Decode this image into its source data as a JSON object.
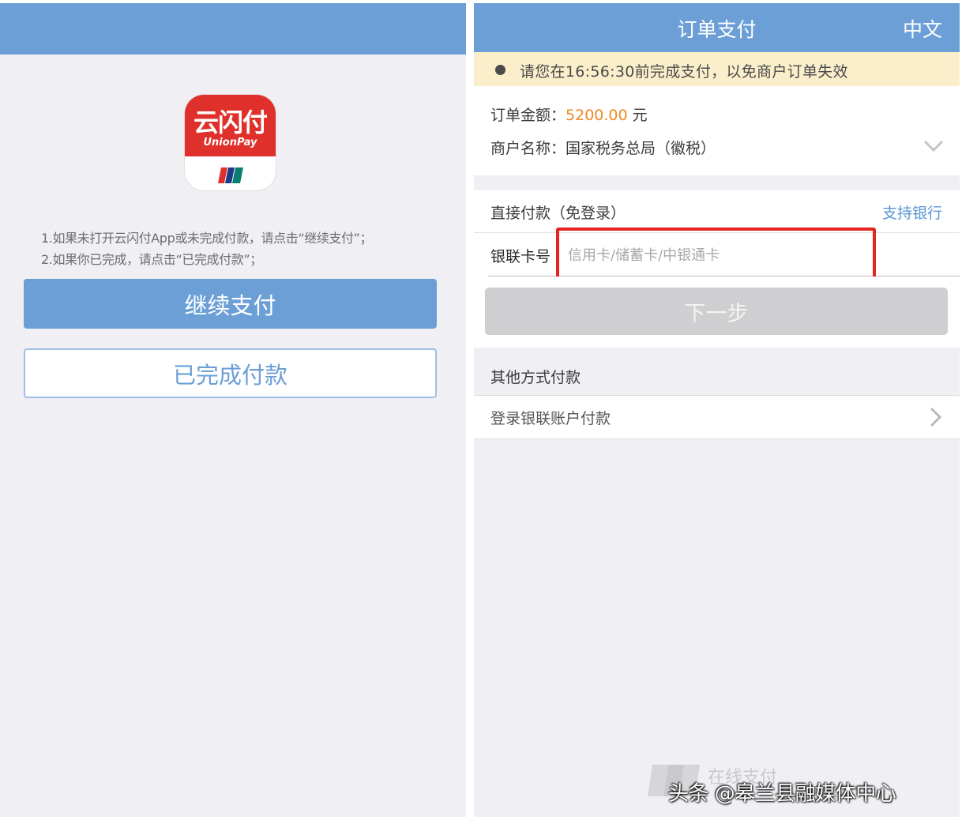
{
  "left": {
    "app_icon": {
      "name_cn": "云闪付",
      "name_en": "UnionPay"
    },
    "instructions": [
      "1.如果未打开云闪付App或未完成付款，请点击“继续支付”；",
      "2.如果你已完成，请点击“已完成付款”；"
    ],
    "continue_label": "继续支付",
    "done_label": "已完成付款"
  },
  "right": {
    "header": {
      "title": "订单支付",
      "lang": "中文"
    },
    "notice": "请您在16:56:30前完成支付，以免商户订单失效",
    "order": {
      "amount_label": "订单金额：",
      "amount_value": "5200.00",
      "amount_unit": "元",
      "merchant_label": "商户名称：",
      "merchant_value": "国家税务总局（徽税）"
    },
    "direct": {
      "label": "直接付款（免登录）",
      "link": "支持银行"
    },
    "card": {
      "label": "银联卡号",
      "placeholder": "信用卡/储蓄卡/中银通卡",
      "value": ""
    },
    "next_label": "下一步",
    "other": {
      "title": "其他方式付款",
      "login_label": "登录银联账户付款"
    },
    "watermark": {
      "faded_text": "在线支付",
      "credit": "头条 @皋兰县融媒体中心"
    }
  },
  "colors": {
    "header_blue": "#6b9fd6",
    "button_blue": "#6b9fd6",
    "notice_bg": "#fbefcb",
    "amount_orange": "#f08a24",
    "highlight_red": "#e3241f",
    "disabled_gray": "#cfcfd2",
    "unionpay_red": "#e0302b"
  },
  "icons": [
    "chevron-down-icon",
    "chevron-right-icon",
    "unionpay-app-icon",
    "notice-dot-icon"
  ]
}
